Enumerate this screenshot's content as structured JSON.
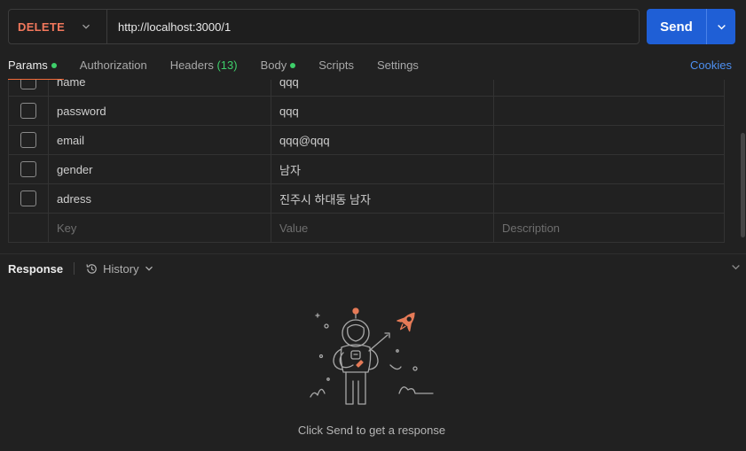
{
  "request": {
    "method": "DELETE",
    "url": "http://localhost:3000/1",
    "send_label": "Send"
  },
  "tabs": [
    {
      "label": "Params",
      "dot": true
    },
    {
      "label": "Authorization"
    },
    {
      "label": "Headers",
      "count": "(13)"
    },
    {
      "label": "Body",
      "dot": true
    },
    {
      "label": "Scripts"
    },
    {
      "label": "Settings"
    }
  ],
  "cookies_label": "Cookies",
  "params": {
    "rows": [
      {
        "key": "name",
        "value": "qqq",
        "description": ""
      },
      {
        "key": "password",
        "value": "qqq",
        "description": ""
      },
      {
        "key": "email",
        "value": "qqq@qqq",
        "description": ""
      },
      {
        "key": "gender",
        "value": "남자",
        "description": ""
      },
      {
        "key": "adress",
        "value": "진주시 하대동 남자",
        "description": ""
      }
    ],
    "placeholder": {
      "key": "Key",
      "value": "Value",
      "description": "Description"
    }
  },
  "response": {
    "title": "Response",
    "history_label": "History",
    "empty_message": "Click Send to get a response"
  },
  "colors": {
    "accent_method": "#f2785c",
    "send_button": "#1f5fd6",
    "active_dot": "#3ecf6a",
    "link": "#4d8ff0",
    "tab_underline": "#f26b3a"
  }
}
